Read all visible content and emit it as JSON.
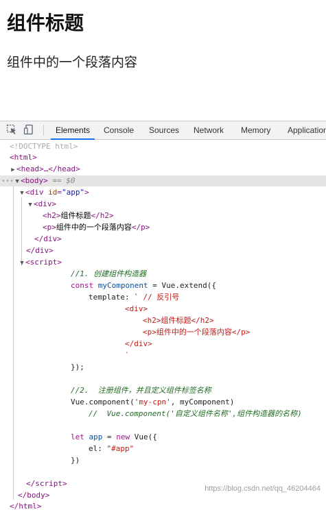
{
  "page": {
    "heading": "组件标题",
    "paragraph": "组件中的一个段落内容"
  },
  "devtools": {
    "tabs": [
      "Elements",
      "Console",
      "Sources",
      "Network",
      "Memory",
      "Application"
    ],
    "active_tab": "Elements",
    "icons": [
      "inspect-cursor-icon",
      "device-toggle-icon"
    ]
  },
  "dom": {
    "doctype": "<!DOCTYPE html>",
    "html_open": "<html>",
    "head_collapsed": "<head>…</head>",
    "body_open": "<body>",
    "selected_marker": " == $0",
    "div_app_tag": "div",
    "div_app_attr": "id",
    "div_app_val": "\"app\"",
    "h2_text": "组件标题",
    "p_text": "组件中的一个段落内容",
    "script_comment1": "//1. 创建组件构造器",
    "line_const_kw": "const",
    "line_const_var": "myComponent",
    "line_const_rest": " = Vue.extend({",
    "template_prefix": "template: ` ",
    "template_comment": "// 反引号",
    "tpl_div_open": "<div>",
    "tpl_h2": "<h2>组件标题</h2>",
    "tpl_p": "<p>组件中的一个段落内容</p>",
    "tpl_div_close": "</div>",
    "tpl_backtick": "`",
    "close_extend": "});",
    "script_comment2": "//2.  注册组件，并且定义组件标签名称",
    "vue_component_pre": "Vue.component(",
    "vue_component_str": "'my-cpn'",
    "vue_component_post": ", myComponent)",
    "script_comment3": "//  Vue.component('自定义组件名称',组件构造器的名称)",
    "let_kw": "let",
    "let_var": "app",
    "let_mid": " = ",
    "let_new": "new",
    "let_rest": " Vue({",
    "el_key": "el: ",
    "el_val": "\"#app\"",
    "close_vue": "})"
  },
  "watermark": "https://blog.csdn.net/qq_46204464"
}
